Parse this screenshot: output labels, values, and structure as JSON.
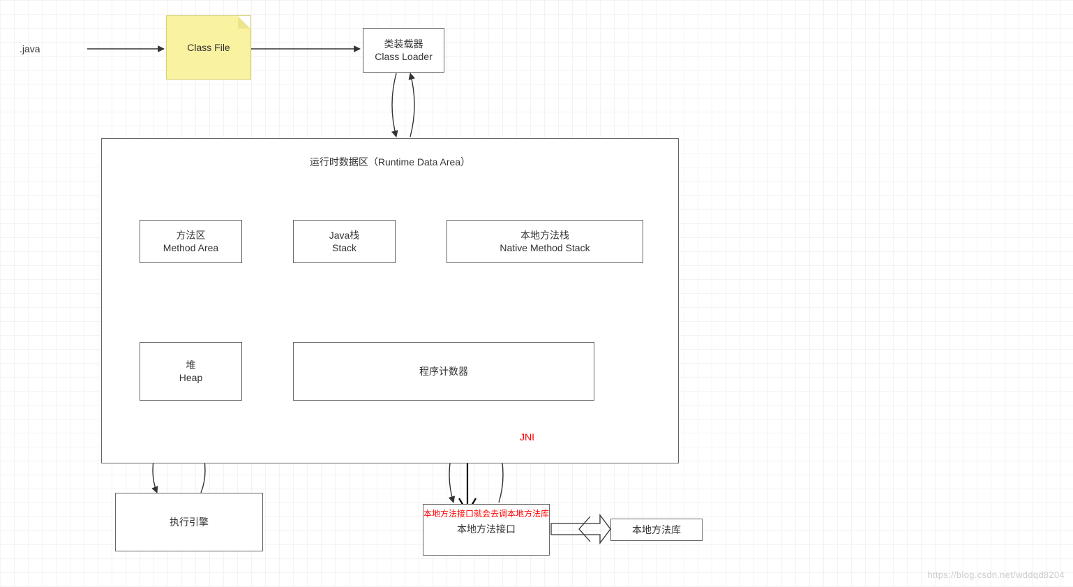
{
  "labels": {
    "java_text": ".java",
    "class_file": "Class File",
    "class_loader_top": "类装载器",
    "class_loader_bottom": "Class Loader",
    "runtime_area_title": "运行时数据区（Runtime Data Area）",
    "method_area_top": "方法区",
    "method_area_bottom": "Method Area",
    "java_stack_top": "Java栈",
    "java_stack_bottom": "Stack",
    "native_stack_top": "本地方法栈",
    "native_stack_bottom": "Native Method Stack",
    "heap_top": "堆",
    "heap_bottom": "Heap",
    "pc_register": "程序计数器",
    "jni": "JNI",
    "exec_engine": "执行引擎",
    "native_if_call": "本地方法接口就会去调本地方法库",
    "native_if": "本地方法接口",
    "native_lib": "本地方法库"
  },
  "watermark": "https://blog.csdn.net/wddqd8204"
}
